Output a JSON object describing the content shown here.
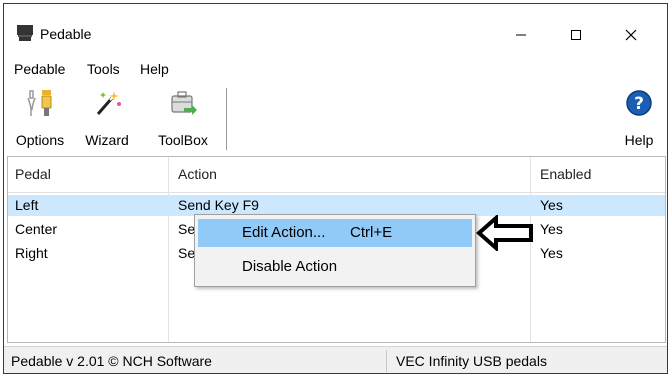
{
  "window": {
    "title": "Pedable",
    "app_icon": "podium-icon",
    "controls": {
      "minimize": "—",
      "maximize": "☐",
      "close": "✕"
    }
  },
  "menu": [
    "Pedable",
    "Tools",
    "Help"
  ],
  "toolbar": {
    "options_label": "Options",
    "wizard_label": "Wizard",
    "toolbox_label": "ToolBox",
    "help_label": "Help",
    "icons": [
      "options-icon",
      "wizard-icon",
      "toolbox-icon",
      "help-icon"
    ]
  },
  "table": {
    "columns": [
      "Pedal",
      "Action",
      "Enabled"
    ],
    "rows": [
      {
        "pedal": "Left",
        "action": "Send Key F9",
        "enabled": "Yes",
        "selected": true
      },
      {
        "pedal": "Center",
        "action": "Se",
        "enabled": "Yes",
        "selected": false
      },
      {
        "pedal": "Right",
        "action": "Se",
        "enabled": "Yes",
        "selected": false
      }
    ]
  },
  "context_menu": {
    "items": [
      {
        "label": "Edit Action...",
        "shortcut": "Ctrl+E",
        "highlighted": true
      },
      {
        "label": "Disable Action",
        "shortcut": "",
        "highlighted": false
      }
    ]
  },
  "annotation": {
    "arrow_icon": "left-arrow-icon"
  },
  "status": {
    "version": "Pedable v 2.01 © NCH Software",
    "device": "VEC Infinity USB pedals"
  },
  "colors": {
    "selected_row": "#cce8ff",
    "menu_highlight": "#91c9f7",
    "help_blue": "#1a5fb4"
  }
}
